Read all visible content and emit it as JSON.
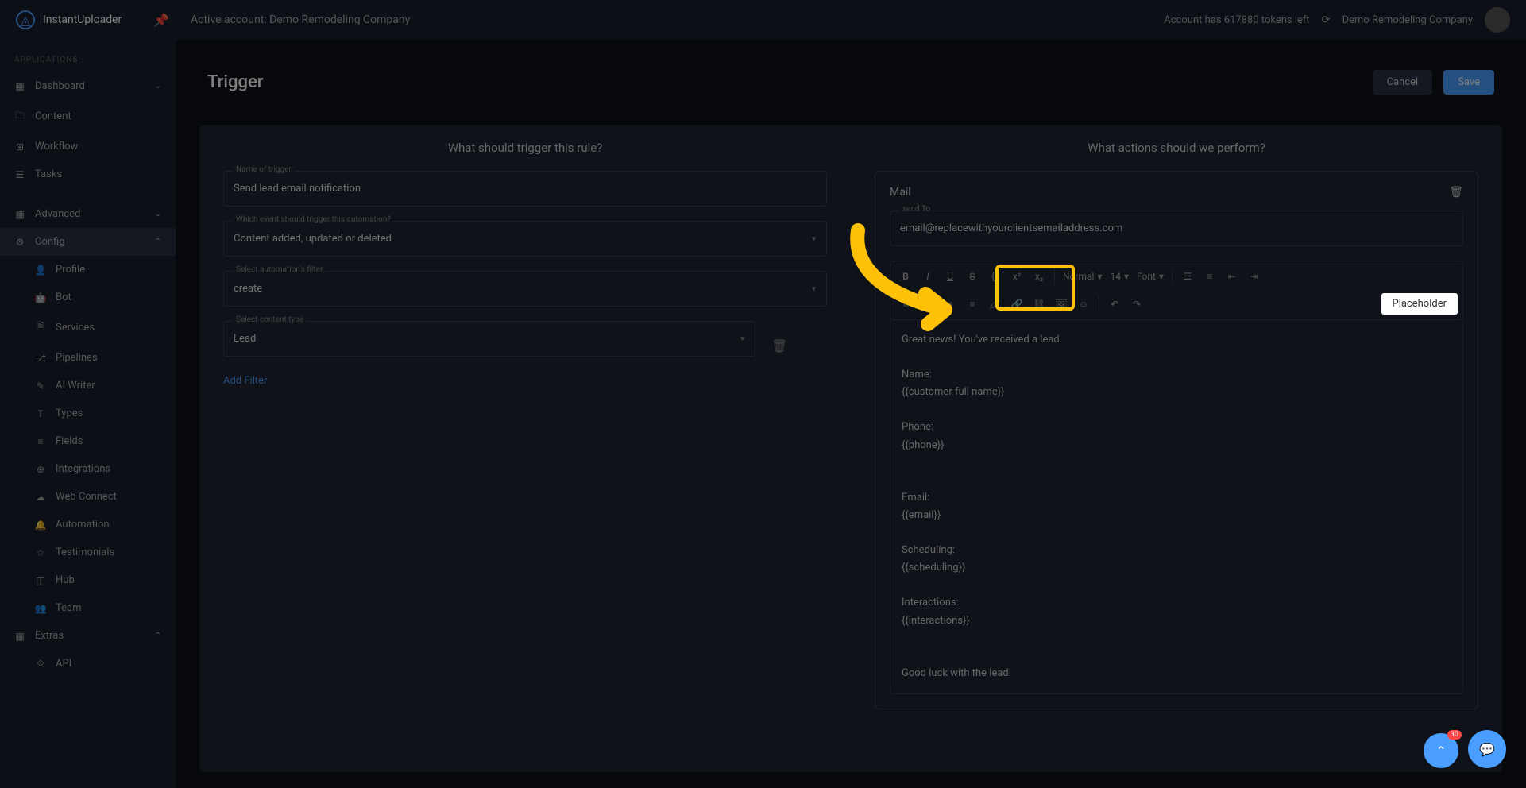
{
  "brand": "InstantUploader",
  "topbar": {
    "active_account": "Active account: Demo Remodeling Company",
    "tokens": "Account has 617880 tokens left",
    "company": "Demo Remodeling Company"
  },
  "sidebar": {
    "section": "APPLICATIONS",
    "items": {
      "dashboard": "Dashboard",
      "content": "Content",
      "workflow": "Workflow",
      "tasks": "Tasks",
      "advanced": "Advanced",
      "config": "Config",
      "profile": "Profile",
      "bot": "Bot",
      "services": "Services",
      "pipelines": "Pipelines",
      "ai_writer": "AI Writer",
      "types": "Types",
      "fields": "Fields",
      "integrations": "Integrations",
      "web_connect": "Web Connect",
      "automation": "Automation",
      "testimonials": "Testimonials",
      "hub": "Hub",
      "team": "Team",
      "extras": "Extras",
      "api": "API"
    }
  },
  "page": {
    "title": "Trigger",
    "cancel": "Cancel",
    "save": "Save",
    "left_title": "What should trigger this rule?",
    "right_title": "What actions should we perform?"
  },
  "trigger": {
    "name_label": "Name of trigger",
    "name_value": "Send lead email notification",
    "event_label": "Which event should trigger this automation?",
    "event_value": "Content added, updated or deleted",
    "filter_label": "Select automation's filter",
    "filter_value": "create",
    "content_type_label": "Select content type",
    "content_type_value": "Lead",
    "add_filter": "Add Filter"
  },
  "mail": {
    "title": "Mail",
    "to_label": "send To",
    "to_value": "email@replacewithyourclientsemailaddress.com",
    "format_normal": "Normal",
    "format_size": "14",
    "format_font": "Font",
    "placeholder_btn": "Placeholder",
    "body": "Great news! You've received a lead.\n\nName:\n{{customer full name}}\n\nPhone:\n{{phone}}\n\n\nEmail:\n{{email}}\n\nScheduling:\n{{scheduling}}\n\nInteractions:\n{{interactions}}\n\n\nGood luck with the lead!"
  },
  "badge": "30"
}
